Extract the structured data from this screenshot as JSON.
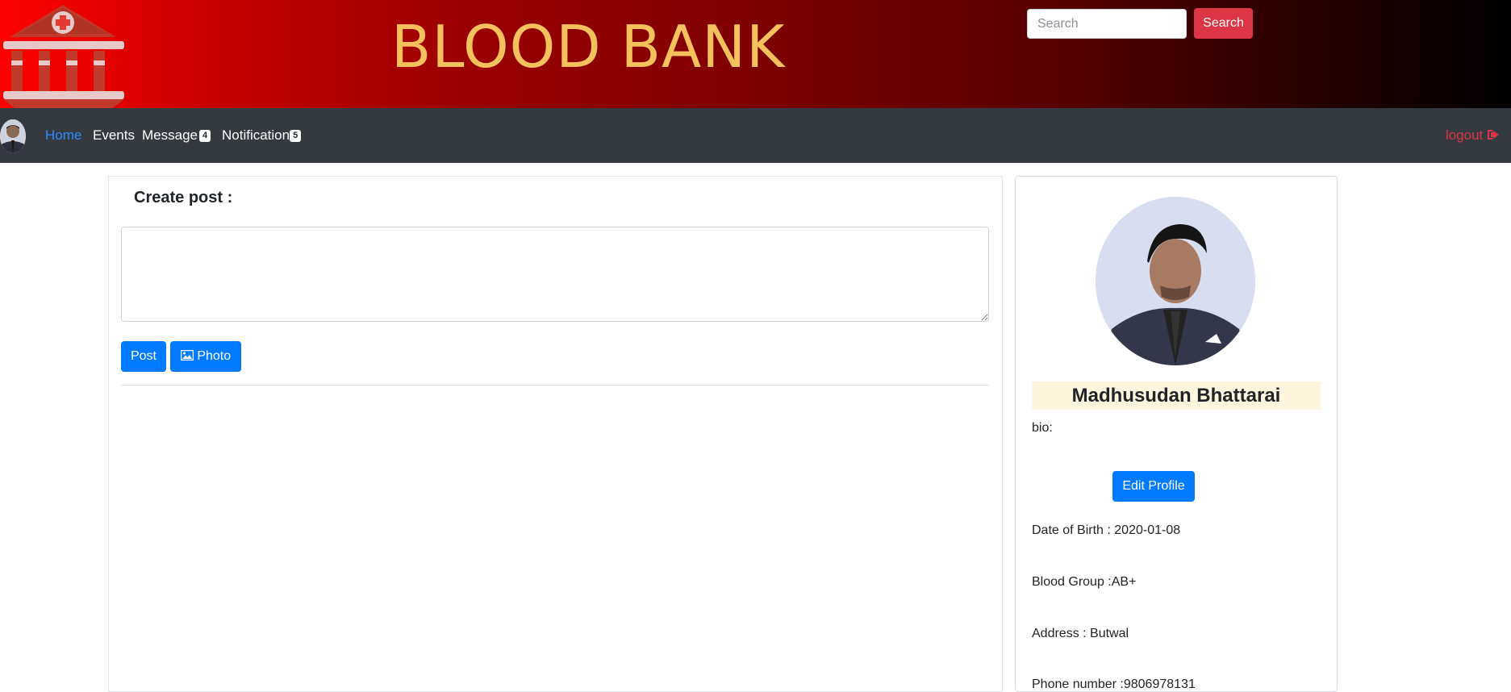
{
  "header": {
    "site_title": "BLOOD BANK",
    "search_placeholder": "Search",
    "search_button_label": "Search",
    "logo_icon": "hospital-building-icon"
  },
  "nav": {
    "items": [
      {
        "label": "Home"
      },
      {
        "label": "Events"
      },
      {
        "label": "Message",
        "badge": "4"
      },
      {
        "label": "Notification",
        "badge": "5"
      }
    ],
    "logout_label": "logout",
    "logout_icon": "sign-out-icon"
  },
  "post": {
    "heading": "Create post :",
    "post_button_label": "Post",
    "photo_button_label": "Photo",
    "photo_icon": "image-icon"
  },
  "profile": {
    "name": "Madhusudan Bhattarai",
    "bio_label": "bio:",
    "edit_button_label": "Edit Profile",
    "dob": "Date of Birth : 2020-01-08",
    "blood_group": "Blood Group :AB+",
    "address": "Address : Butwal",
    "phone": "Phone number :9806978131"
  },
  "colors": {
    "accent": "#007bff",
    "danger": "#dc3545",
    "title": "#f4c15c",
    "navbar": "#343a40"
  }
}
